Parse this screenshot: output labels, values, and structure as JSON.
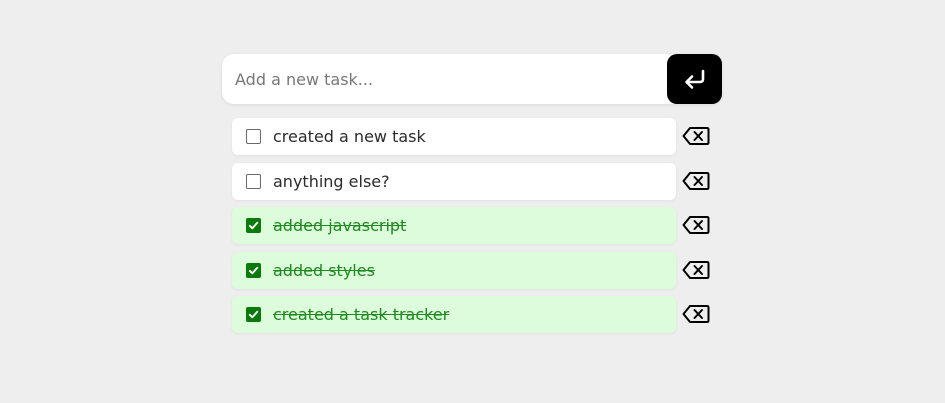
{
  "input": {
    "placeholder": "Add a new task...",
    "value": ""
  },
  "add_button": {
    "icon": "enter-return-icon",
    "color": "#000000"
  },
  "tasks": [
    {
      "text": "created a new task",
      "completed": false
    },
    {
      "text": "anything else?",
      "completed": false
    },
    {
      "text": "added javascript",
      "completed": true
    },
    {
      "text": "added styles",
      "completed": true
    },
    {
      "text": "created a task tracker",
      "completed": true
    }
  ],
  "colors": {
    "background": "#eeeeee",
    "done_background": "#dcfcdc",
    "done_text": "#1f8a1f",
    "check_accent": "#0a7a0a"
  },
  "delete_icon": "backspace-x-icon"
}
